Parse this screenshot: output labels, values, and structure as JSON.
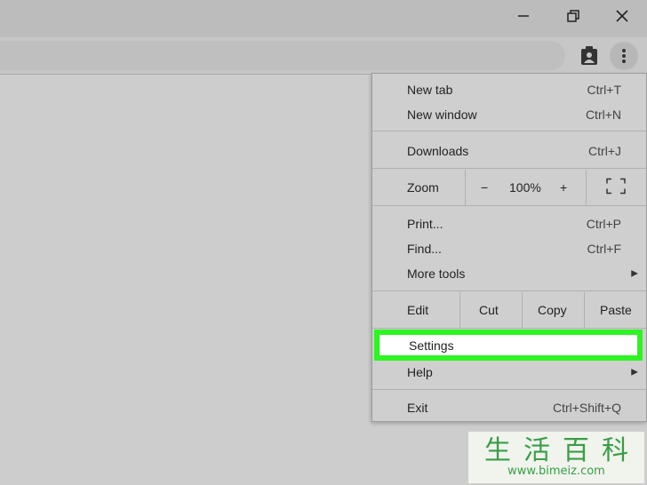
{
  "window": {
    "icons": [
      "minimize-icon",
      "restore-icon",
      "close-icon"
    ]
  },
  "toolbar": {
    "icons": [
      "profile-badge-icon",
      "kebab-menu-icon"
    ]
  },
  "menu": {
    "new_tab": {
      "label": "New tab",
      "shortcut": "Ctrl+T"
    },
    "new_window": {
      "label": "New window",
      "shortcut": "Ctrl+N"
    },
    "downloads": {
      "label": "Downloads",
      "shortcut": "Ctrl+J"
    },
    "zoom": {
      "label": "Zoom",
      "minus": "−",
      "level": "100%",
      "plus": "+"
    },
    "print": {
      "label": "Print...",
      "shortcut": "Ctrl+P"
    },
    "find": {
      "label": "Find...",
      "shortcut": "Ctrl+F"
    },
    "more_tools": {
      "label": "More tools"
    },
    "edit": {
      "label": "Edit",
      "cut": "Cut",
      "copy": "Copy",
      "paste": "Paste"
    },
    "settings": {
      "label": "Settings"
    },
    "help": {
      "label": "Help"
    },
    "exit": {
      "label": "Exit",
      "shortcut": "Ctrl+Shift+Q"
    }
  },
  "highlight_color": "#2df522",
  "watermark": {
    "chinese": "生活百科",
    "url": "www.bimeiz.com"
  }
}
